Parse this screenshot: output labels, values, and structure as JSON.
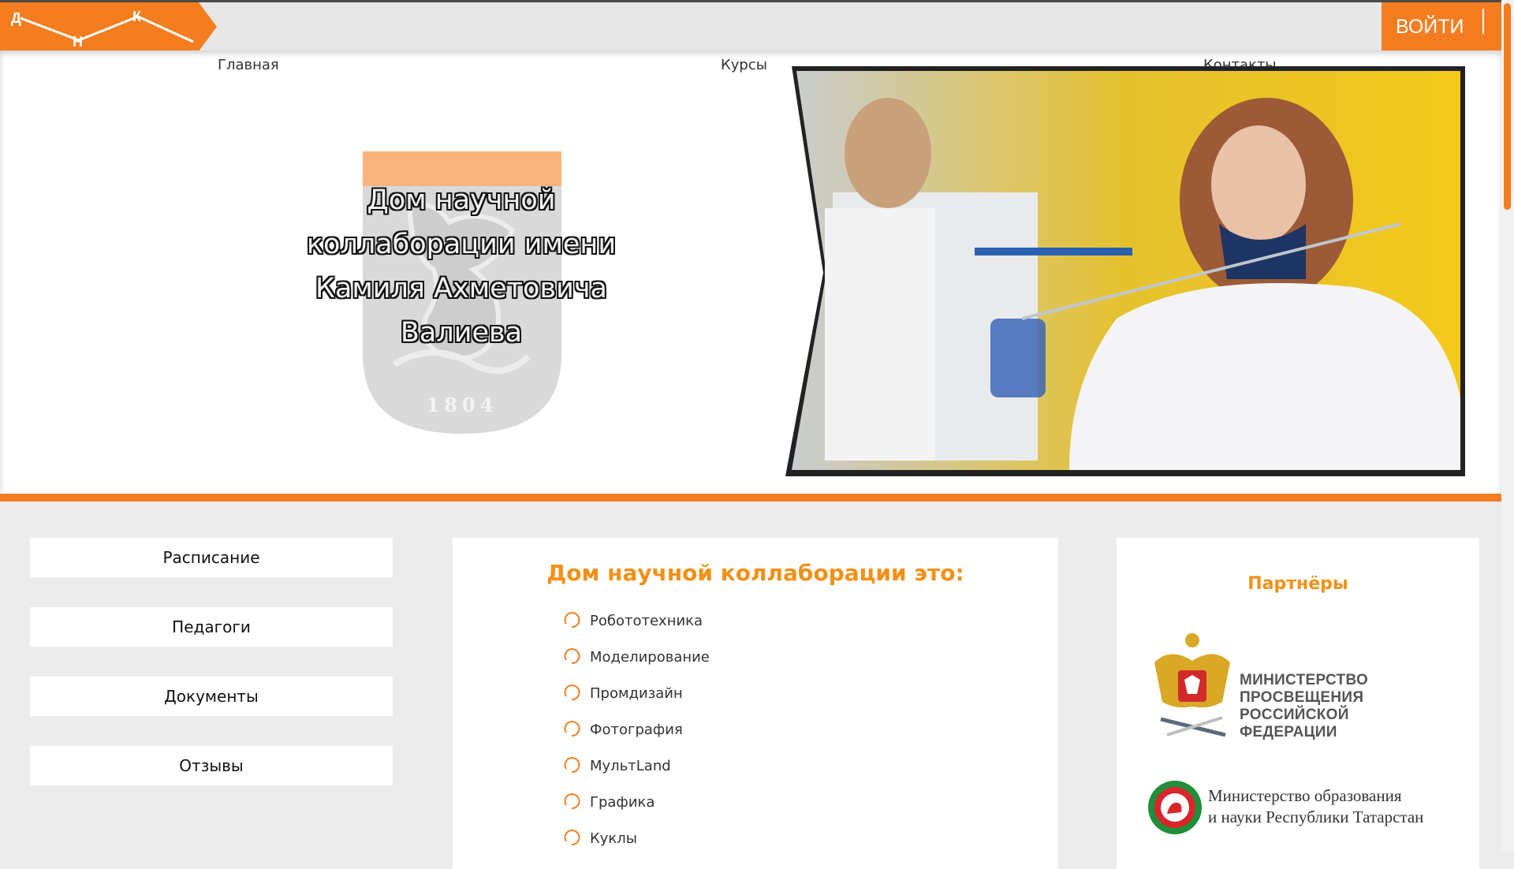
{
  "header": {
    "logo_letters": [
      "Д",
      "Н",
      "К"
    ],
    "login_label": "ВОЙТИ"
  },
  "nav": {
    "items": [
      {
        "label": "Главная"
      },
      {
        "label": "Курсы"
      },
      {
        "label": "Контакты"
      }
    ]
  },
  "hero": {
    "title_lines": [
      "Дом научной",
      "коллаборации имени",
      "Камиля Ахметовича",
      "Валиева"
    ],
    "emblem_year": "1804"
  },
  "sidebar": {
    "buttons": [
      {
        "label": "Расписание"
      },
      {
        "label": "Педагоги"
      },
      {
        "label": "Документы"
      },
      {
        "label": "Отзывы"
      }
    ]
  },
  "about": {
    "title": "Дом научной коллаборации это:",
    "items": [
      "Робототехника",
      "Моделирование",
      "Промдизайн",
      "Фотография",
      "МультLand",
      "Графика",
      "Куклы"
    ]
  },
  "partners": {
    "title": "Партнёры",
    "minpros_lines": [
      "МИНИСТЕРСТВО",
      "ПРОСВЕЩЕНИЯ",
      "РОССИЙСКОЙ ФЕДЕРАЦИИ"
    ],
    "minobr_lines": [
      "Министерство образования",
      "и науки Республики Татарстан"
    ]
  },
  "colors": {
    "accent": "#f47d20",
    "heading": "#f29016",
    "background": "#ececec"
  }
}
